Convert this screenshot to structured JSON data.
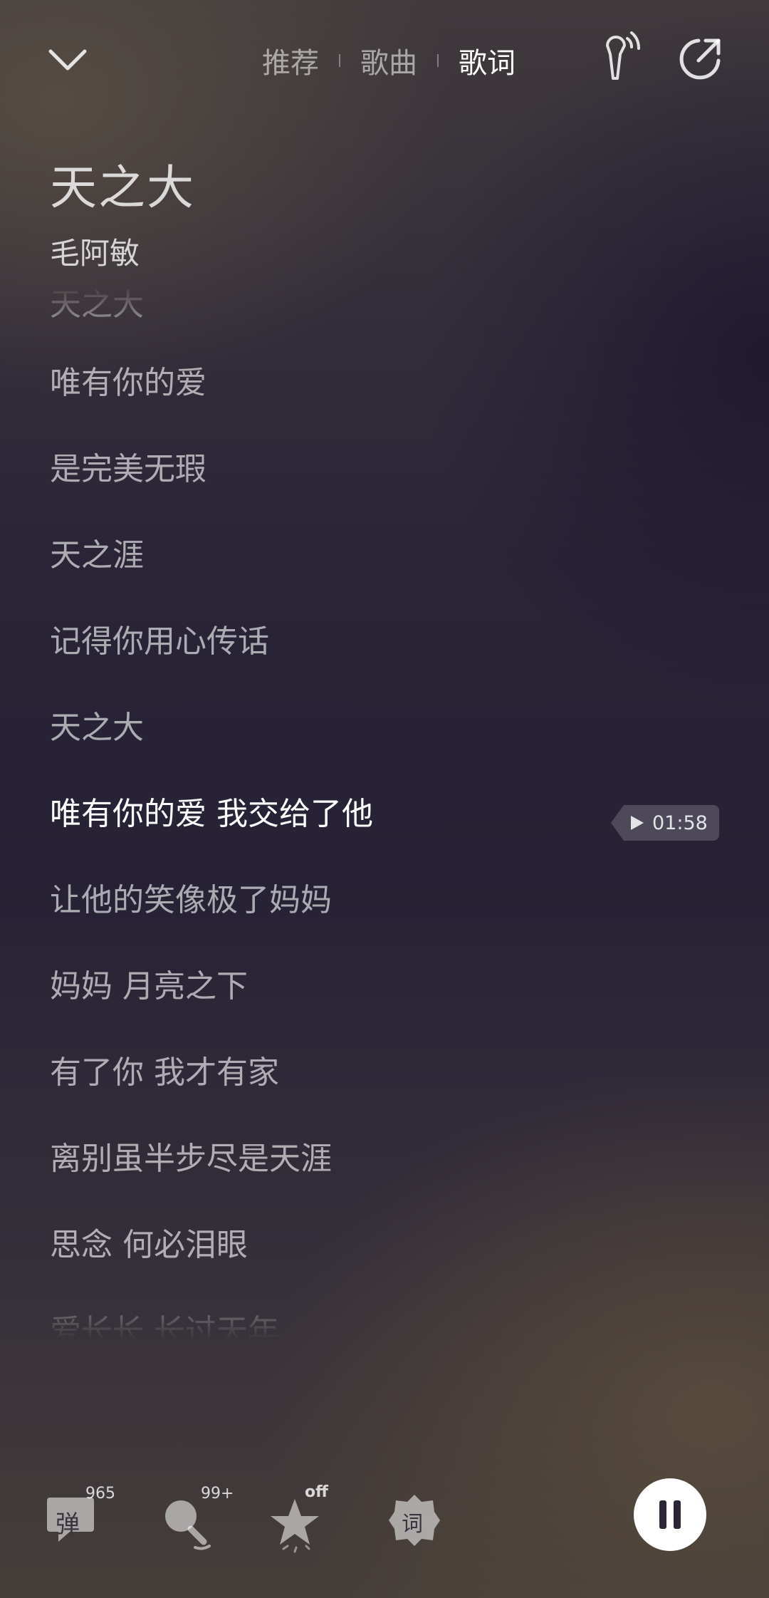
{
  "header": {
    "tabs": [
      {
        "label": "推荐",
        "active": false
      },
      {
        "label": "歌曲",
        "active": false
      },
      {
        "label": "歌词",
        "active": true
      }
    ],
    "icons": {
      "back": "chevron-down-icon",
      "sing": "microphone-icon",
      "share": "share-icon"
    }
  },
  "song": {
    "title": "天之大",
    "artist": "毛阿敏"
  },
  "lyrics": {
    "lines": [
      "天之大",
      "唯有你的爱",
      "是完美无瑕",
      "天之涯",
      "记得你用心传话",
      "天之大",
      "唯有你的爱 我交给了他",
      "让他的笑像极了妈妈",
      "妈妈 月亮之下",
      "有了你 我才有家",
      "离别虽半步尽是天涯",
      "思念 何必泪眼",
      "爱长长 长过天年"
    ],
    "current_index": 6,
    "seek_time": "01:58"
  },
  "bottom_bar": {
    "danmaku": {
      "glyph": "弹",
      "count": "965"
    },
    "comments": {
      "count": "99+"
    },
    "effects": {
      "status": "off"
    },
    "lyrics_btn": {
      "glyph": "词"
    },
    "playing": true
  }
}
